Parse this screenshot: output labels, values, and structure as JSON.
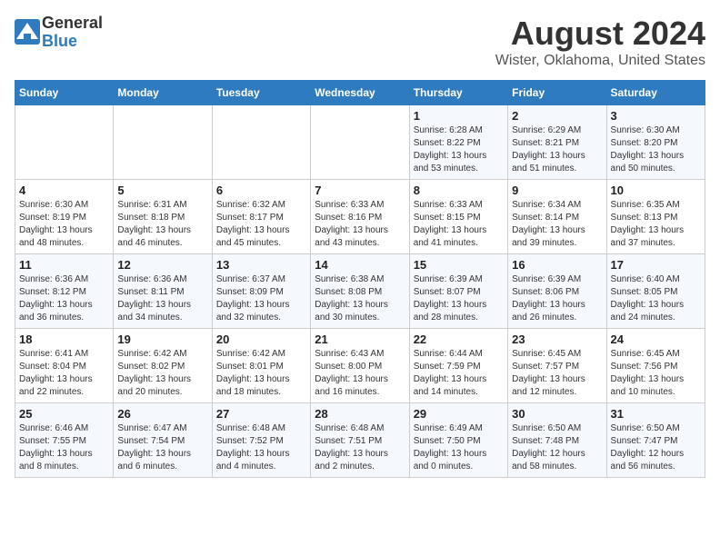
{
  "header": {
    "logo_general": "General",
    "logo_blue": "Blue",
    "month_year": "August 2024",
    "location": "Wister, Oklahoma, United States"
  },
  "days_of_week": [
    "Sunday",
    "Monday",
    "Tuesday",
    "Wednesday",
    "Thursday",
    "Friday",
    "Saturday"
  ],
  "weeks": [
    [
      {
        "day": "",
        "info": ""
      },
      {
        "day": "",
        "info": ""
      },
      {
        "day": "",
        "info": ""
      },
      {
        "day": "",
        "info": ""
      },
      {
        "day": "1",
        "info": "Sunrise: 6:28 AM\nSunset: 8:22 PM\nDaylight: 13 hours\nand 53 minutes."
      },
      {
        "day": "2",
        "info": "Sunrise: 6:29 AM\nSunset: 8:21 PM\nDaylight: 13 hours\nand 51 minutes."
      },
      {
        "day": "3",
        "info": "Sunrise: 6:30 AM\nSunset: 8:20 PM\nDaylight: 13 hours\nand 50 minutes."
      }
    ],
    [
      {
        "day": "4",
        "info": "Sunrise: 6:30 AM\nSunset: 8:19 PM\nDaylight: 13 hours\nand 48 minutes."
      },
      {
        "day": "5",
        "info": "Sunrise: 6:31 AM\nSunset: 8:18 PM\nDaylight: 13 hours\nand 46 minutes."
      },
      {
        "day": "6",
        "info": "Sunrise: 6:32 AM\nSunset: 8:17 PM\nDaylight: 13 hours\nand 45 minutes."
      },
      {
        "day": "7",
        "info": "Sunrise: 6:33 AM\nSunset: 8:16 PM\nDaylight: 13 hours\nand 43 minutes."
      },
      {
        "day": "8",
        "info": "Sunrise: 6:33 AM\nSunset: 8:15 PM\nDaylight: 13 hours\nand 41 minutes."
      },
      {
        "day": "9",
        "info": "Sunrise: 6:34 AM\nSunset: 8:14 PM\nDaylight: 13 hours\nand 39 minutes."
      },
      {
        "day": "10",
        "info": "Sunrise: 6:35 AM\nSunset: 8:13 PM\nDaylight: 13 hours\nand 37 minutes."
      }
    ],
    [
      {
        "day": "11",
        "info": "Sunrise: 6:36 AM\nSunset: 8:12 PM\nDaylight: 13 hours\nand 36 minutes."
      },
      {
        "day": "12",
        "info": "Sunrise: 6:36 AM\nSunset: 8:11 PM\nDaylight: 13 hours\nand 34 minutes."
      },
      {
        "day": "13",
        "info": "Sunrise: 6:37 AM\nSunset: 8:09 PM\nDaylight: 13 hours\nand 32 minutes."
      },
      {
        "day": "14",
        "info": "Sunrise: 6:38 AM\nSunset: 8:08 PM\nDaylight: 13 hours\nand 30 minutes."
      },
      {
        "day": "15",
        "info": "Sunrise: 6:39 AM\nSunset: 8:07 PM\nDaylight: 13 hours\nand 28 minutes."
      },
      {
        "day": "16",
        "info": "Sunrise: 6:39 AM\nSunset: 8:06 PM\nDaylight: 13 hours\nand 26 minutes."
      },
      {
        "day": "17",
        "info": "Sunrise: 6:40 AM\nSunset: 8:05 PM\nDaylight: 13 hours\nand 24 minutes."
      }
    ],
    [
      {
        "day": "18",
        "info": "Sunrise: 6:41 AM\nSunset: 8:04 PM\nDaylight: 13 hours\nand 22 minutes."
      },
      {
        "day": "19",
        "info": "Sunrise: 6:42 AM\nSunset: 8:02 PM\nDaylight: 13 hours\nand 20 minutes."
      },
      {
        "day": "20",
        "info": "Sunrise: 6:42 AM\nSunset: 8:01 PM\nDaylight: 13 hours\nand 18 minutes."
      },
      {
        "day": "21",
        "info": "Sunrise: 6:43 AM\nSunset: 8:00 PM\nDaylight: 13 hours\nand 16 minutes."
      },
      {
        "day": "22",
        "info": "Sunrise: 6:44 AM\nSunset: 7:59 PM\nDaylight: 13 hours\nand 14 minutes."
      },
      {
        "day": "23",
        "info": "Sunrise: 6:45 AM\nSunset: 7:57 PM\nDaylight: 13 hours\nand 12 minutes."
      },
      {
        "day": "24",
        "info": "Sunrise: 6:45 AM\nSunset: 7:56 PM\nDaylight: 13 hours\nand 10 minutes."
      }
    ],
    [
      {
        "day": "25",
        "info": "Sunrise: 6:46 AM\nSunset: 7:55 PM\nDaylight: 13 hours\nand 8 minutes."
      },
      {
        "day": "26",
        "info": "Sunrise: 6:47 AM\nSunset: 7:54 PM\nDaylight: 13 hours\nand 6 minutes."
      },
      {
        "day": "27",
        "info": "Sunrise: 6:48 AM\nSunset: 7:52 PM\nDaylight: 13 hours\nand 4 minutes."
      },
      {
        "day": "28",
        "info": "Sunrise: 6:48 AM\nSunset: 7:51 PM\nDaylight: 13 hours\nand 2 minutes."
      },
      {
        "day": "29",
        "info": "Sunrise: 6:49 AM\nSunset: 7:50 PM\nDaylight: 13 hours\nand 0 minutes."
      },
      {
        "day": "30",
        "info": "Sunrise: 6:50 AM\nSunset: 7:48 PM\nDaylight: 12 hours\nand 58 minutes."
      },
      {
        "day": "31",
        "info": "Sunrise: 6:50 AM\nSunset: 7:47 PM\nDaylight: 12 hours\nand 56 minutes."
      }
    ]
  ]
}
